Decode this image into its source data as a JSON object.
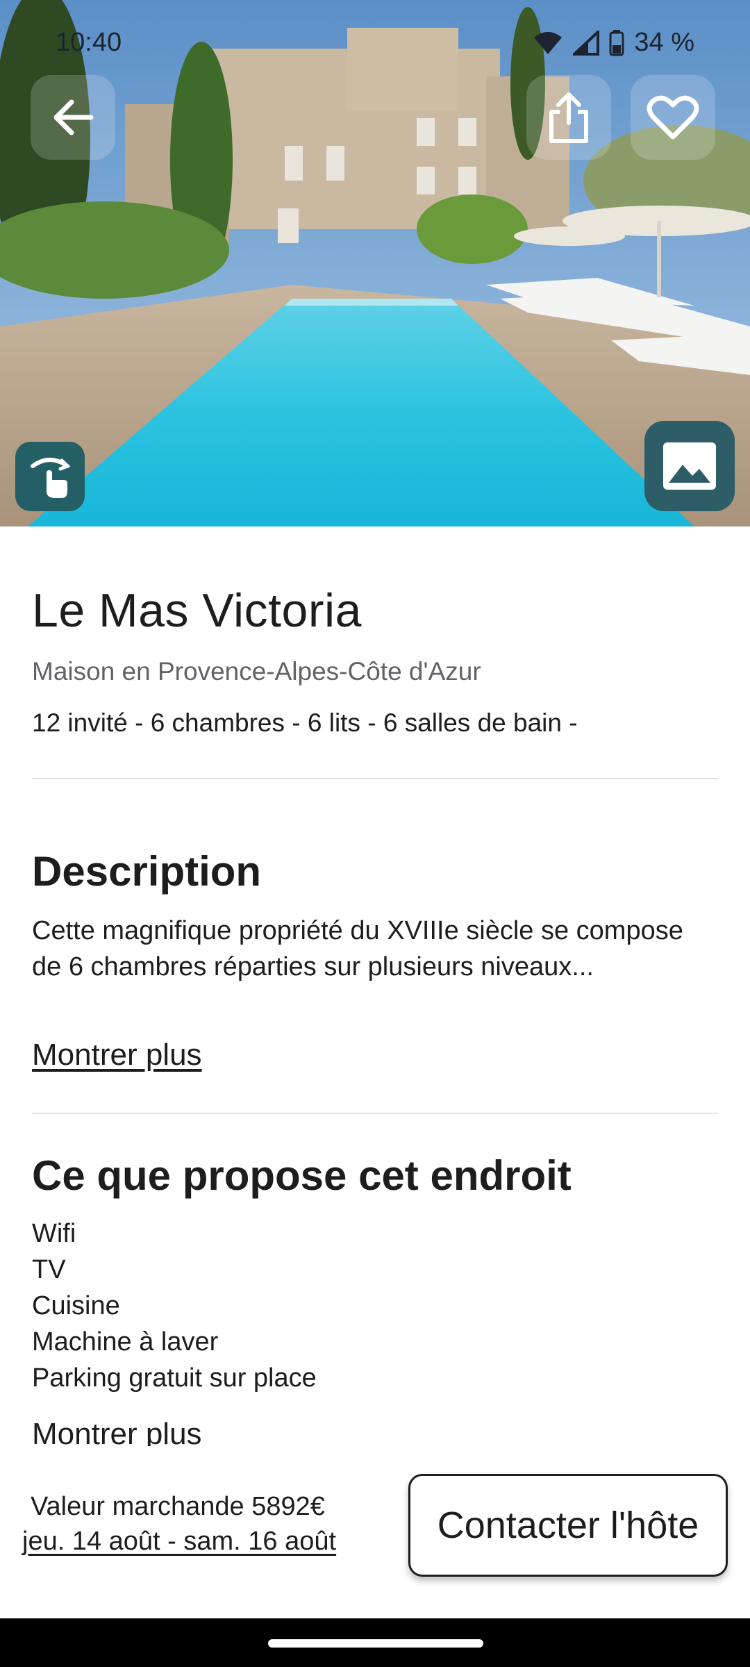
{
  "status_bar": {
    "time": "10:40",
    "battery": "34 %",
    "icons": [
      "wifi-icon",
      "signal-icon",
      "battery-icon"
    ]
  },
  "hero": {
    "image_alt": "photo-pool-stone-house",
    "buttons": {
      "back": "arrow-left-icon",
      "share": "share-icon",
      "favorite": "heart-icon",
      "tour": "touch-rotate-icon",
      "gallery": "image-icon"
    }
  },
  "listing": {
    "title": "Le Mas Victoria",
    "subtitle": "Maison en Provence-Alpes-Côte d'Azur",
    "specs": "12 invité - 6 chambres - 6 lits - 6 salles de bain -"
  },
  "description": {
    "heading": "Description",
    "text": "Cette magnifique propriété du XVIIIe siècle se compose de 6 chambres réparties sur plusieurs niveaux...",
    "more_label": "Montrer plus"
  },
  "amenities": {
    "heading": "Ce que propose cet endroit",
    "items": [
      "Wifi",
      "TV",
      "Cuisine",
      "Machine à laver",
      "Parking gratuit sur place"
    ],
    "more_label": "Montrer plus"
  },
  "footer": {
    "price_label": "Valeur marchande 5892€",
    "dates_label": "jeu. 14 août - sam. 16 août",
    "contact_label": "Contacter l'hôte"
  },
  "colors": {
    "accent_teal": "#245f66",
    "text": "#1d1d1d",
    "subtle_text": "#5f6368",
    "divider": "#e1e1e1"
  }
}
